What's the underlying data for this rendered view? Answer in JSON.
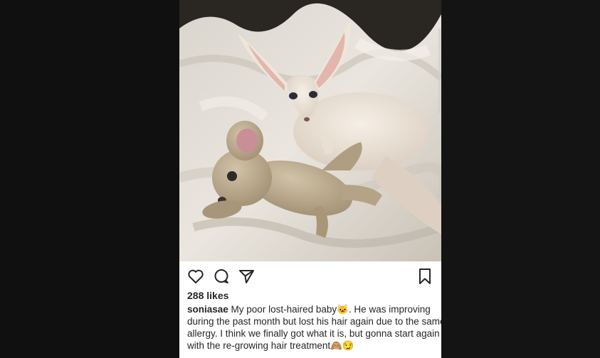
{
  "post": {
    "likes": "288 likes",
    "username": "soniasae",
    "caption_lines": [
      " My poor lost-haired baby🐱. He was improving",
      "during the past month but lost his hair again due to the same",
      "allergy. I think we finally got what it is, but gonna start again",
      "with the re-growing hair treatment🙈😏"
    ]
  },
  "icons": {
    "like": "heart-icon",
    "comment": "comment-icon",
    "share": "send-icon",
    "save": "bookmark-icon"
  },
  "colors": {
    "icon": "#262626",
    "text": "#262626",
    "background": "#ffffff"
  }
}
